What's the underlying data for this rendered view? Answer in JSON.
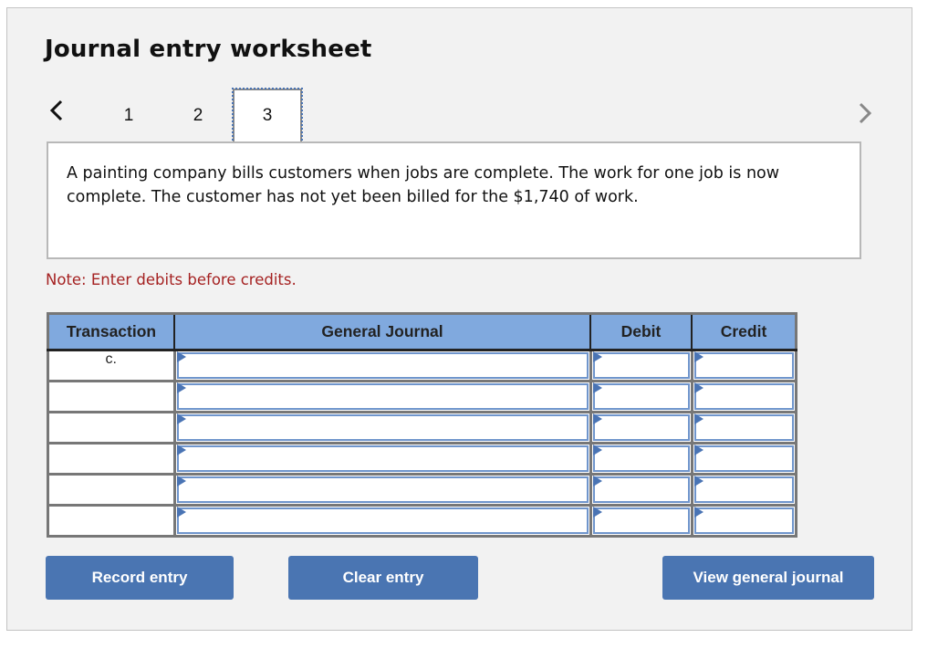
{
  "header": {
    "title": "Journal entry worksheet"
  },
  "navigation": {
    "prev_icon": "chevron-left-icon",
    "next_icon": "chevron-right-icon",
    "tabs": [
      {
        "label": "1",
        "active": false
      },
      {
        "label": "2",
        "active": false
      },
      {
        "label": "3",
        "active": true
      }
    ]
  },
  "prompt": {
    "text": "A painting company bills customers when jobs are complete. The work for one job is now complete. The customer has not yet been billed for the $1,740 of work."
  },
  "note": "Note: Enter debits before credits.",
  "table": {
    "columns": [
      "Transaction",
      "General Journal",
      "Debit",
      "Credit"
    ],
    "rows": [
      {
        "transaction": "c.",
        "account": "",
        "debit": "",
        "credit": ""
      },
      {
        "transaction": "",
        "account": "",
        "debit": "",
        "credit": ""
      },
      {
        "transaction": "",
        "account": "",
        "debit": "",
        "credit": ""
      },
      {
        "transaction": "",
        "account": "",
        "debit": "",
        "credit": ""
      },
      {
        "transaction": "",
        "account": "",
        "debit": "",
        "credit": ""
      },
      {
        "transaction": "",
        "account": "",
        "debit": "",
        "credit": ""
      }
    ]
  },
  "buttons": {
    "record": "Record entry",
    "clear": "Clear entry",
    "view": "View general journal"
  },
  "colors": {
    "accent": "#4a75b2",
    "header_bg": "#80a9de",
    "note": "#a52222",
    "panel_bg": "#f2f2f2"
  }
}
